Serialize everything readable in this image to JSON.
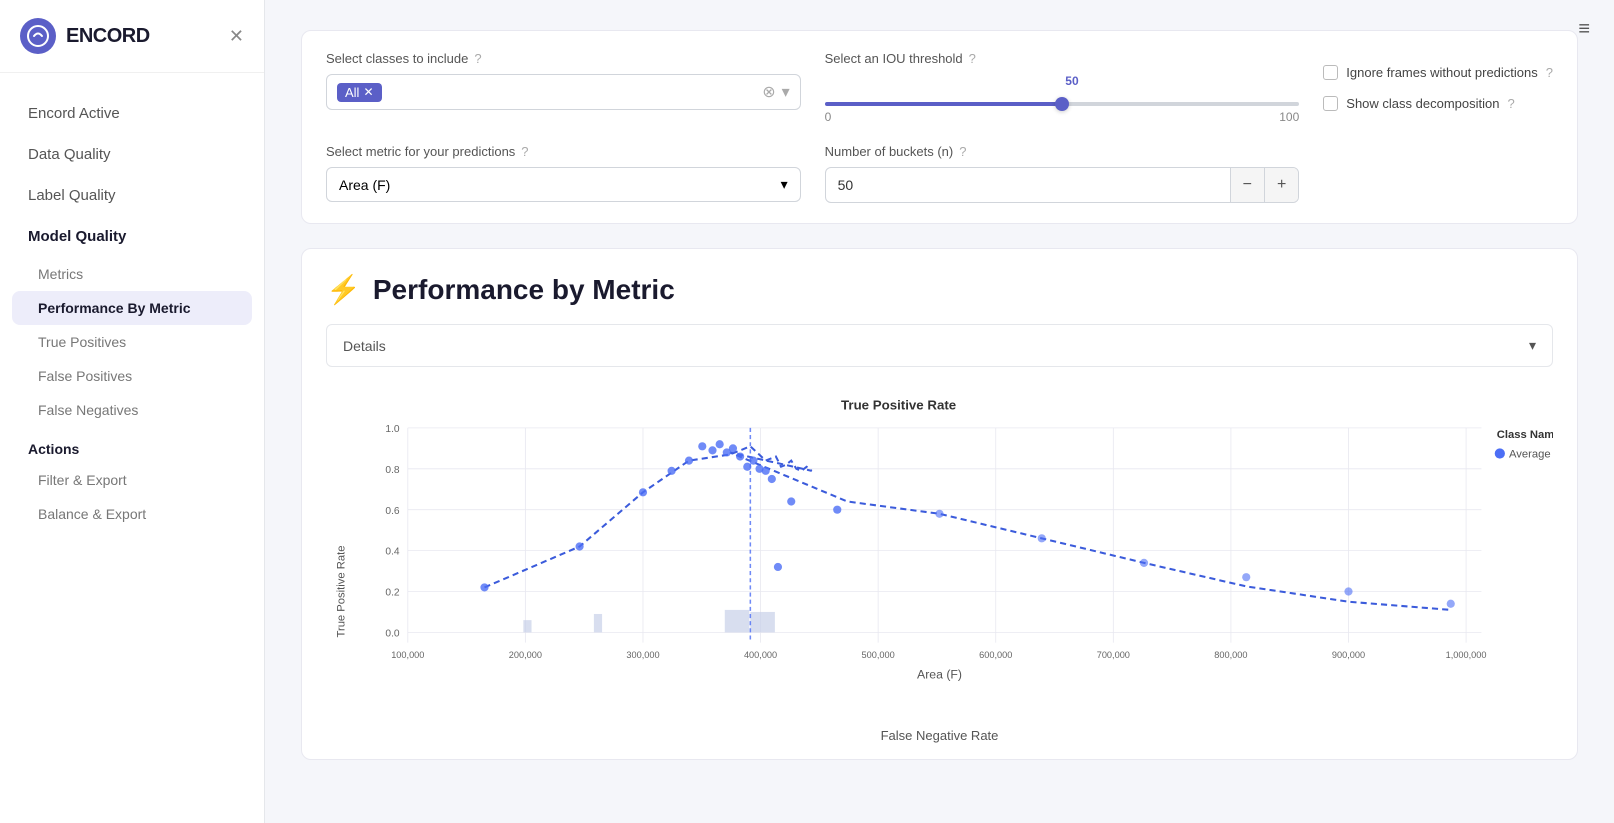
{
  "sidebar": {
    "logo_letter": "e",
    "logo_text": "ENCORD",
    "nav_items": [
      {
        "id": "encord-active",
        "label": "Encord Active",
        "type": "main"
      },
      {
        "id": "data-quality",
        "label": "Data Quality",
        "type": "main"
      },
      {
        "id": "label-quality",
        "label": "Label Quality",
        "type": "main"
      },
      {
        "id": "model-quality",
        "label": "Model Quality",
        "type": "section"
      },
      {
        "id": "metrics",
        "label": "Metrics",
        "type": "sub"
      },
      {
        "id": "performance-by-metric",
        "label": "Performance By Metric",
        "type": "sub",
        "active": true
      },
      {
        "id": "true-positives",
        "label": "True Positives",
        "type": "sub"
      },
      {
        "id": "false-positives",
        "label": "False Positives",
        "type": "sub"
      },
      {
        "id": "false-negatives",
        "label": "False Negatives",
        "type": "sub"
      },
      {
        "id": "actions",
        "label": "Actions",
        "type": "section"
      },
      {
        "id": "filter-export",
        "label": "Filter & Export",
        "type": "sub"
      },
      {
        "id": "balance-export",
        "label": "Balance & Export",
        "type": "sub"
      }
    ]
  },
  "controls": {
    "classes_label": "Select classes to include",
    "classes_tag": "All",
    "iou_label": "Select an IOU threshold",
    "iou_value": "50",
    "iou_min": "0",
    "iou_max": "100",
    "metric_label": "Select metric for your predictions",
    "metric_value": "Area (F)",
    "buckets_label": "Number of buckets (n)",
    "buckets_value": "50",
    "ignore_label": "Ignore frames without predictions",
    "decomp_label": "Show class decomposition"
  },
  "chart": {
    "title": "Performance by Metric",
    "details_label": "Details",
    "y_axis_label_top": "True Positive Rate",
    "x_axis_label": "Area (F)",
    "y_axis_label_bottom": "False Negative Rate",
    "legend_title": "Class Name",
    "legend_average": "Average",
    "y_ticks": [
      "1.0",
      "0.8",
      "0.6",
      "0.4",
      "0.2",
      "0.0"
    ],
    "x_ticks": [
      "100,000",
      "200,000",
      "300,000",
      "400,000",
      "500,000",
      "600,000",
      "700,000",
      "800,000",
      "900,000",
      "1,000,000"
    ]
  },
  "topbar": {
    "menu_icon": "≡"
  }
}
